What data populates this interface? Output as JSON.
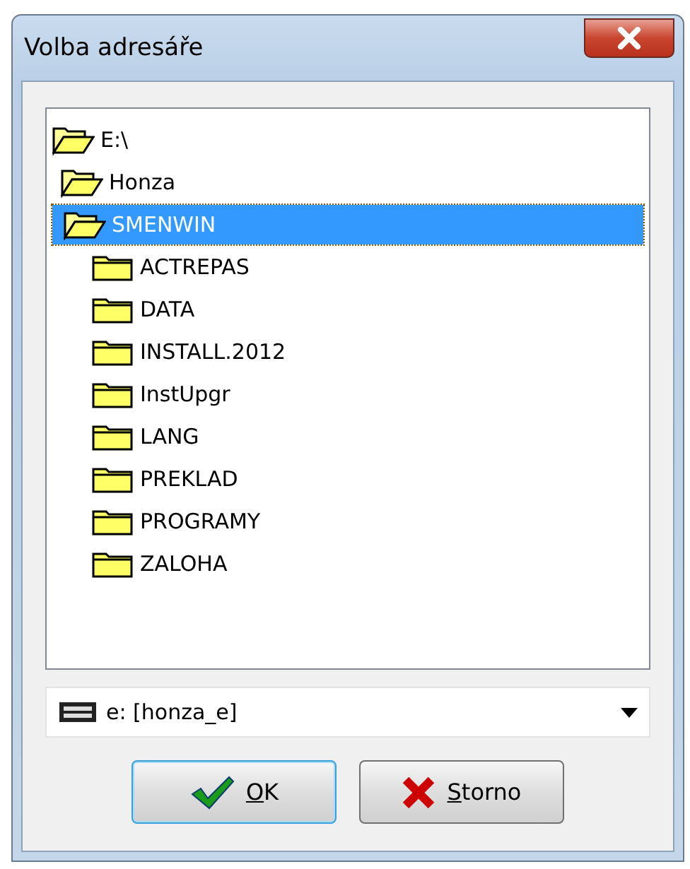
{
  "window": {
    "title": "Volba adresáře"
  },
  "tree": [
    {
      "label": "E:\\",
      "expanded": true,
      "selected": false,
      "children": [
        {
          "label": "Honza",
          "expanded": true,
          "selected": false,
          "children": [
            {
              "label": "SMENWIN",
              "expanded": true,
              "selected": true,
              "children": [
                {
                  "label": "ACTREPAS",
                  "expanded": false,
                  "selected": false
                },
                {
                  "label": "DATA",
                  "expanded": false,
                  "selected": false
                },
                {
                  "label": "INSTALL.2012",
                  "expanded": false,
                  "selected": false
                },
                {
                  "label": "InstUpgr",
                  "expanded": false,
                  "selected": false
                },
                {
                  "label": "LANG",
                  "expanded": false,
                  "selected": false
                },
                {
                  "label": "PREKLAD",
                  "expanded": false,
                  "selected": false
                },
                {
                  "label": "PROGRAMY",
                  "expanded": false,
                  "selected": false
                },
                {
                  "label": "ZALOHA",
                  "expanded": false,
                  "selected": false
                }
              ]
            }
          ]
        }
      ]
    }
  ],
  "drive_select": {
    "value": "e: [honza_e]"
  },
  "buttons": [
    {
      "label": "OK",
      "kind": "ok"
    },
    {
      "label": "Storno",
      "kind": "cancel"
    }
  ]
}
